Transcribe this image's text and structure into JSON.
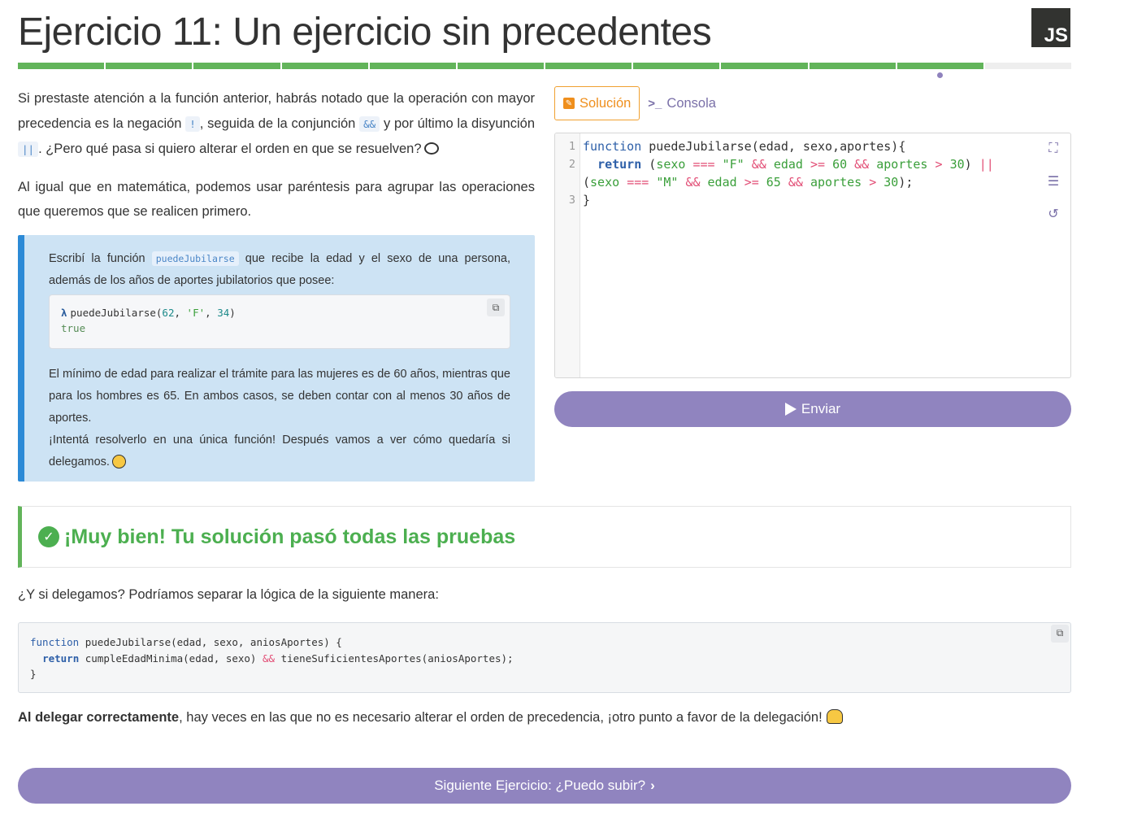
{
  "header": {
    "title": "Ejercicio 11: Un ejercicio sin precedentes",
    "logo_text": "JS",
    "progress": {
      "total": 12,
      "completed": 11,
      "current": 11
    }
  },
  "intro": {
    "p1_part1": "Si prestaste atención a la función anterior, habrás notado que la operación con mayor precedencia es la negación ",
    "p1_code1": "!",
    "p1_part2": ", seguida de la conjunción ",
    "p1_code2": "&&",
    "p1_part3": " y por último la disyunción ",
    "p1_code3": "||",
    "p1_part4": ". ¿Pero qué pasa si quiero alterar el orden en que se resuelven?",
    "p2": "Al igual que en matemática, podemos usar paréntesis para agrupar las operaciones que queremos que se realicen primero."
  },
  "task": {
    "text1_part1": "Escribí la función ",
    "text1_code": "puedeJubilarse",
    "text1_part2": " que recibe la edad y el sexo de una persona, además de los años de aportes jubilatorios que posee:",
    "example_call": "puedeJubilarse(",
    "example_arg1": "62",
    "example_sep1": ", ",
    "example_arg2": "'F'",
    "example_sep2": ", ",
    "example_arg3": "34",
    "example_close": ")",
    "example_result": "true",
    "text2": "El mínimo de edad para realizar el trámite para las mujeres es de 60 años, mientras que para los hombres es 65. En ambos casos, se deben contar con al menos 30 años de aportes.",
    "text3": "¡Intentá resolverlo en una única función! Después vamos a ver cómo quedaría si delegamos."
  },
  "tabs": {
    "solution_label": "Solución",
    "console_label": "Consola"
  },
  "editor": {
    "line_numbers": [
      "1",
      "2",
      "3"
    ]
  },
  "send_button": {
    "label": "Enviar"
  },
  "success": {
    "message": "¡Muy bien! Tu solución pasó todas las pruebas"
  },
  "delegate_question": "¿Y si delegamos? Podríamos separar la lógica de la siguiente manera:",
  "closing": {
    "bold": "Al delegar correctamente",
    "rest": ", hay veces en las que no es necesario alterar el orden de precedencia, ¡otro punto a favor de la delegación!"
  },
  "next_button": {
    "label": "Siguiente Ejercicio: ¿Puedo subir?"
  },
  "colors": {
    "progress_done": "#62b45a",
    "accent_purple": "#9084bf",
    "tab_active": "#ef8f1d",
    "success_green": "#4caf50",
    "task_bg": "#cde3f4",
    "task_border": "#2c8ad6"
  },
  "icons": {
    "solution_tab": "edit-icon",
    "console_tab": "terminal-icon",
    "fullscreen": "expand-icon",
    "indent": "indent-icon",
    "reset": "undo-icon",
    "copy": "copy-icon",
    "success": "check-circle-icon",
    "send": "play-icon",
    "next": "chevron-right-icon"
  }
}
